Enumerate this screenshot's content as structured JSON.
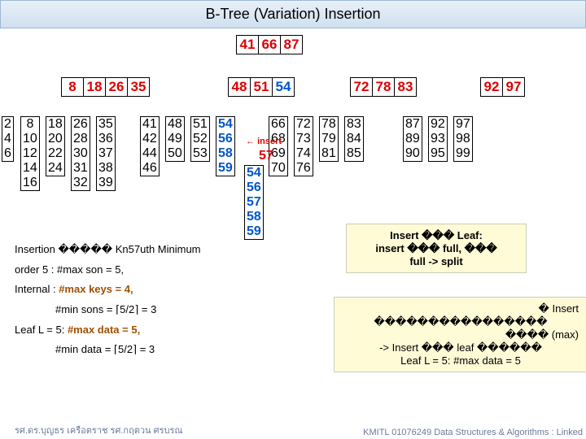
{
  "title": "B-Tree (Variation) Insertion",
  "root": [
    "41",
    "66",
    "87"
  ],
  "l1": [
    [
      "8",
      "18",
      "26",
      "35"
    ],
    [
      "48",
      "51",
      "54"
    ],
    [
      "72",
      "78",
      "83"
    ],
    [
      "92",
      "97"
    ]
  ],
  "leaves": [
    [
      "2",
      "4",
      "6"
    ],
    [
      "8",
      "10",
      "12",
      "14",
      "16"
    ],
    [
      "18",
      "20",
      "22",
      "24"
    ],
    [
      "26",
      "28",
      "30",
      "31",
      "32"
    ],
    [
      "35",
      "36",
      "37",
      "38",
      "39"
    ],
    [
      "41",
      "42",
      "44",
      "46"
    ],
    [
      "48",
      "49",
      "50"
    ],
    [
      "51",
      "52",
      "53"
    ],
    [
      "54",
      "56",
      "58",
      "59"
    ],
    [
      "66",
      "68",
      "69",
      "70"
    ],
    [
      "72",
      "73",
      "74",
      "76"
    ],
    [
      "78",
      "79",
      "81"
    ],
    [
      "83",
      "84",
      "85"
    ],
    [
      "87",
      "89",
      "90"
    ],
    [
      "92",
      "93",
      "95"
    ],
    [
      "97",
      "98",
      "99"
    ]
  ],
  "ins_lbl": "insert",
  "ins_val": "57",
  "spill": [
    "54",
    "56",
    "57",
    "58",
    "59"
  ],
  "left": {
    "l1": "Insertion ����� Kn57uth Minimum",
    "l2": "order 5  : #max son = 5,",
    "l3": "Internal : #max keys = 4,",
    "l4": "#min sons = ⌈5/2⌉ = 3",
    "l5": "Leaf L = 5: #max data = 5,",
    "l6": "#min data = ⌈5/2⌉ = 3"
  },
  "box1": {
    "a": "Insert ��� Leaf:",
    "b": "insert ��� full, ���",
    "c": "full -> split"
  },
  "box2": {
    "a": "� Insert",
    "b": "����������������",
    "c": "���� (max)",
    "d": "-> Insert ��� leaf ������",
    "e": "Leaf L = 5:  #max data = 5"
  },
  "footL": "รศ.ดร.บุญธร    เครือตราช      รศ.กฤตวน  ศรบรณ",
  "footR": "KMITL 01076249 Data Structures & Algorithms : Linked"
}
